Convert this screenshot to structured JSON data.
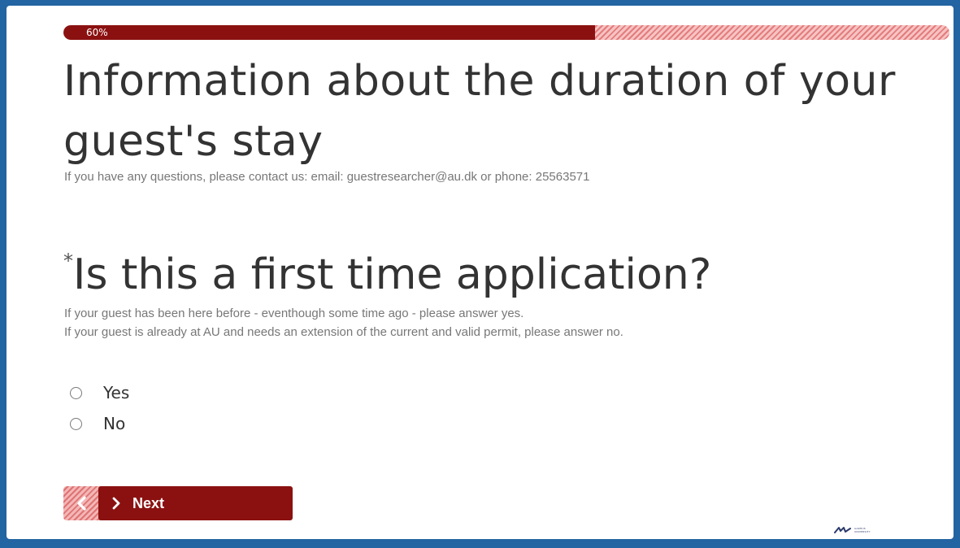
{
  "progress": {
    "label": "60%",
    "percent": 60,
    "fill_color": "#8b1111",
    "stripe_color": "#e47c7c"
  },
  "page": {
    "title": "Information about the duration of your guest's stay",
    "contact": "If you have any questions, please contact us: email: guestresearcher@au.dk or phone: 25563571"
  },
  "question": {
    "required_marker": "*",
    "text": "Is this a first time application?",
    "help_line_1": "If your guest has been here before - eventhough some time ago - please answer yes.",
    "help_line_2": "If your guest is already at AU and needs an extension of the current and valid permit, please answer no.",
    "options": [
      {
        "label": "Yes",
        "selected": false
      },
      {
        "label": "No",
        "selected": false
      }
    ]
  },
  "navigation": {
    "back_icon": "chevron-left-icon",
    "next_icon": "chevron-right-icon",
    "next_label": "Next",
    "button_color": "#8b1111"
  },
  "logo": {
    "name": "au-logo-icon",
    "line_1": "AARHUS",
    "line_2": "UNIVERSITY"
  },
  "colors": {
    "frame_border": "#2364a2",
    "text": "#333333",
    "muted_text": "#777777"
  }
}
